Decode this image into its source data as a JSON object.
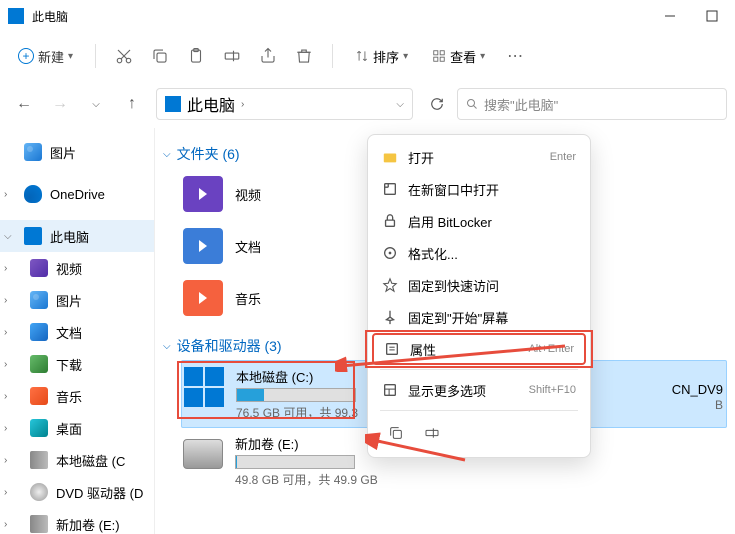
{
  "titlebar": {
    "title": "此电脑"
  },
  "toolbar": {
    "new_label": "新建",
    "sort_label": "排序",
    "view_label": "查看"
  },
  "nav": {
    "address": "此电脑",
    "search_placeholder": "搜索\"此电脑\""
  },
  "sidebar": {
    "pinned": {
      "label": "图片"
    },
    "onedrive": {
      "label": "OneDrive"
    },
    "thispc": {
      "label": "此电脑"
    },
    "items": [
      {
        "label": "视频",
        "icon": "video"
      },
      {
        "label": "图片",
        "icon": "picture"
      },
      {
        "label": "文档",
        "icon": "document"
      },
      {
        "label": "下载",
        "icon": "download"
      },
      {
        "label": "音乐",
        "icon": "music"
      },
      {
        "label": "桌面",
        "icon": "desktop"
      },
      {
        "label": "本地磁盘 (C",
        "icon": "disk"
      },
      {
        "label": "DVD 驱动器 (D",
        "icon": "dvd"
      },
      {
        "label": "新加卷 (E:)",
        "icon": "disk"
      }
    ]
  },
  "main": {
    "section_folders": "文件夹 (6)",
    "section_drives": "设备和驱动器 (3)",
    "folders": [
      {
        "label": "视频",
        "color": "#6a42c1"
      },
      {
        "label": "文档",
        "color": "#3b7dd8"
      },
      {
        "label": "音乐",
        "color": "#f5613e"
      }
    ],
    "drives": [
      {
        "name": "本地磁盘 (C:)",
        "detail": "76.5 GB 可用，共 99.3",
        "fill_pct": 23,
        "selected": true,
        "thumb": "windows"
      },
      {
        "name": "新加卷 (E:)",
        "detail": "49.8 GB 可用，共 49.9 GB",
        "fill_pct": 1,
        "selected": false,
        "thumb": "drive"
      }
    ]
  },
  "context_menu": {
    "items": [
      {
        "icon": "folder-open",
        "label": "打开",
        "shortcut": "Enter"
      },
      {
        "icon": "new-window",
        "label": "在新窗口中打开",
        "shortcut": ""
      },
      {
        "icon": "lock",
        "label": "启用 BitLocker",
        "shortcut": ""
      },
      {
        "icon": "format",
        "label": "格式化...",
        "shortcut": ""
      },
      {
        "icon": "pin-star",
        "label": "固定到快速访问",
        "shortcut": ""
      },
      {
        "icon": "pin",
        "label": "固定到\"开始\"屏幕",
        "shortcut": ""
      },
      {
        "icon": "properties",
        "label": "属性",
        "shortcut": "Alt+Enter",
        "highlighted": true
      },
      {
        "icon": "more",
        "label": "显示更多选项",
        "shortcut": "Shift+F10"
      }
    ]
  },
  "partial": {
    "dvd_text": "CN_DV9",
    "b_text": "B"
  }
}
